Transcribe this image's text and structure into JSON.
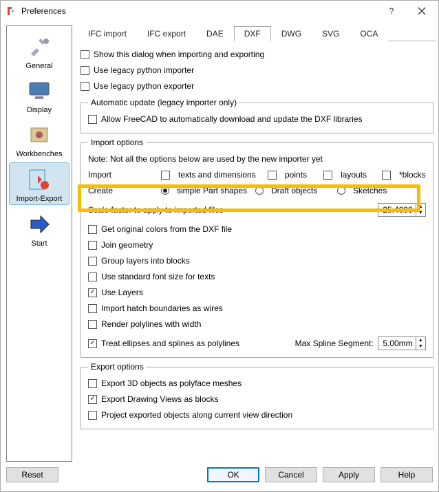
{
  "window": {
    "title": "Preferences"
  },
  "sidebar": {
    "items": [
      {
        "label": "General"
      },
      {
        "label": "Display"
      },
      {
        "label": "Workbenches"
      },
      {
        "label": "Import-Export",
        "selected": true
      },
      {
        "label": "Start"
      }
    ]
  },
  "tabs": [
    "IFC import",
    "IFC export",
    "DAE",
    "DXF",
    "DWG",
    "SVG",
    "OCA"
  ],
  "active_tab": "DXF",
  "top_checks": [
    {
      "label": "Show this dialog when importing and exporting",
      "checked": false
    },
    {
      "label": "Use legacy python importer",
      "checked": false
    },
    {
      "label": "Use legacy python exporter",
      "checked": false
    }
  ],
  "auto_update": {
    "legend": "Automatic update (legacy importer only)",
    "allow_label": "Allow FreeCAD to automatically download and update the DXF libraries",
    "allow_checked": false
  },
  "import_options": {
    "legend": "Import options",
    "note": "Note: Not all the options below are used by the new importer yet",
    "import_label": "Import",
    "import_checks": [
      {
        "label": "texts and dimensions",
        "checked": false
      },
      {
        "label": "points",
        "checked": false
      },
      {
        "label": "layouts",
        "checked": false
      },
      {
        "label": "*blocks",
        "checked": false
      }
    ],
    "create_label": "Create",
    "create_opts": [
      {
        "label": "simple Part shapes",
        "checked": true
      },
      {
        "label": "Draft objects",
        "checked": false
      },
      {
        "label": "Sketches",
        "checked": false
      }
    ],
    "scale_label": "Scale factor to apply to imported files",
    "scale_value": "25.4000",
    "colors_label": "Get original colors from the DXF file",
    "more_checks": [
      {
        "label": "Join geometry",
        "checked": false
      },
      {
        "label": "Group layers into blocks",
        "checked": false
      },
      {
        "label": "Use standard font size for texts",
        "checked": false
      },
      {
        "label": "Use Layers",
        "checked": true
      },
      {
        "label": "Import hatch boundaries as wires",
        "checked": false
      },
      {
        "label": "Render polylines with width",
        "checked": false
      }
    ],
    "ellipses_label": "Treat ellipses and splines as polylines",
    "ellipses_checked": true,
    "maxspline_label": "Max Spline Segment:",
    "maxspline_value": "5.00mm"
  },
  "export_options": {
    "legend": "Export options",
    "checks": [
      {
        "label": "Export 3D objects as polyface meshes",
        "checked": false
      },
      {
        "label": "Export Drawing Views as blocks",
        "checked": true
      },
      {
        "label": "Project exported objects along current view direction",
        "checked": false
      }
    ]
  },
  "footer": {
    "reset": "Reset",
    "ok": "OK",
    "cancel": "Cancel",
    "apply": "Apply",
    "help": "Help"
  }
}
